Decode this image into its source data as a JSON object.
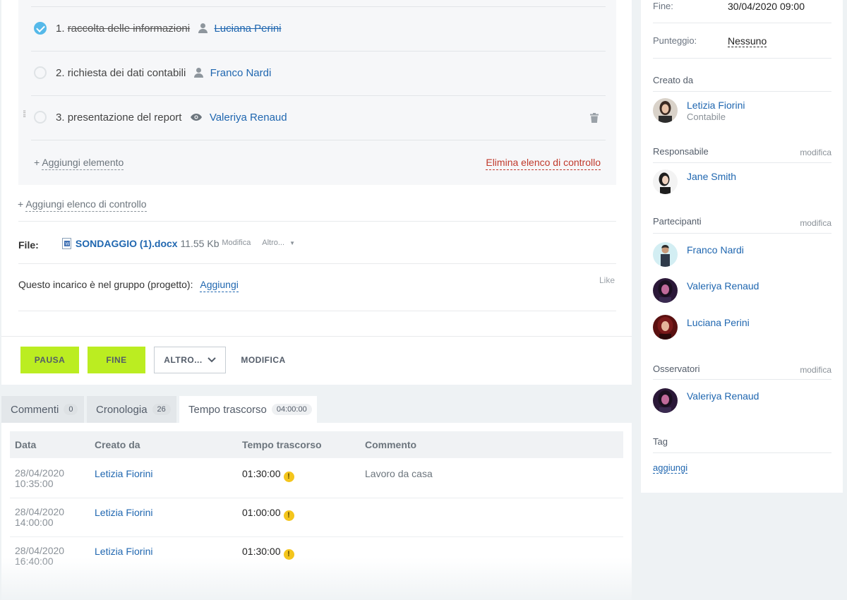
{
  "checklist": {
    "items": [
      {
        "num": "1.",
        "text": "raccolta delle informazioni",
        "person": "Luciana Perini",
        "done": true
      },
      {
        "num": "2.",
        "text": "richiesta dei dati contabili",
        "person": "Franco Nardi",
        "done": false
      },
      {
        "num": "3.",
        "text": "presentazione del report",
        "person": "Valeriya Renaud",
        "done": false
      }
    ],
    "add_item": "Aggiungi elemento",
    "delete_list": "Elimina elenco di controllo",
    "add_list": "Aggiungi elenco di controllo",
    "plus": "+"
  },
  "file": {
    "label": "File:",
    "name": "SONDAGGIO (1).docx",
    "size": "11.55 Kb",
    "edit": "Modifica",
    "more": "Altro..."
  },
  "group": {
    "label": "Questo incarico è nel gruppo (progetto):",
    "add": "Aggiungi",
    "like": "Like"
  },
  "actions": {
    "pause": "PAUSA",
    "finish": "FINE",
    "more": "ALTRO...",
    "edit": "MODIFICA"
  },
  "tabs": [
    {
      "label": "Commenti",
      "badge": "0"
    },
    {
      "label": "Cronologia",
      "badge": "26"
    },
    {
      "label": "Tempo trascorso",
      "badge": "04:00:00"
    }
  ],
  "time_table": {
    "headers": [
      "Data",
      "Creato da",
      "Tempo trascorso",
      "Commento"
    ],
    "rows": [
      {
        "date": "28/04/2020",
        "time": "10:35:00",
        "author": "Letizia Fiorini",
        "spent": "01:30:00",
        "comment": "Lavoro da casa"
      },
      {
        "date": "28/04/2020",
        "time": "14:00:00",
        "author": "Letizia Fiorini",
        "spent": "01:00:00",
        "comment": ""
      },
      {
        "date": "28/04/2020",
        "time": "16:40:00",
        "author": "Letizia Fiorini",
        "spent": "01:30:00",
        "comment": ""
      }
    ],
    "warn": "!"
  },
  "sidebar": {
    "end_label": "Fine:",
    "end_value": "30/04/2020 09:00",
    "score_label": "Punteggio:",
    "score_value": "Nessuno",
    "created_by_title": "Creato da",
    "creator": {
      "name": "Letizia Fiorini",
      "role": "Contabile"
    },
    "responsible_title": "Responsabile",
    "responsible": "Jane Smith",
    "participants_title": "Partecipanti",
    "participants": [
      "Franco Nardi",
      "Valeriya Renaud",
      "Luciana Perini"
    ],
    "observers_title": "Osservatori",
    "observers": [
      "Valeriya Renaud"
    ],
    "tag_title": "Tag",
    "tag_add": "aggiungi",
    "edit": "modifica"
  },
  "colors": {
    "accent_green": "#bbed21",
    "link_blue": "#2067b0",
    "check_blue": "#55b9e9",
    "danger_red": "#c0392b",
    "warn_yellow": "#f4c51c"
  }
}
